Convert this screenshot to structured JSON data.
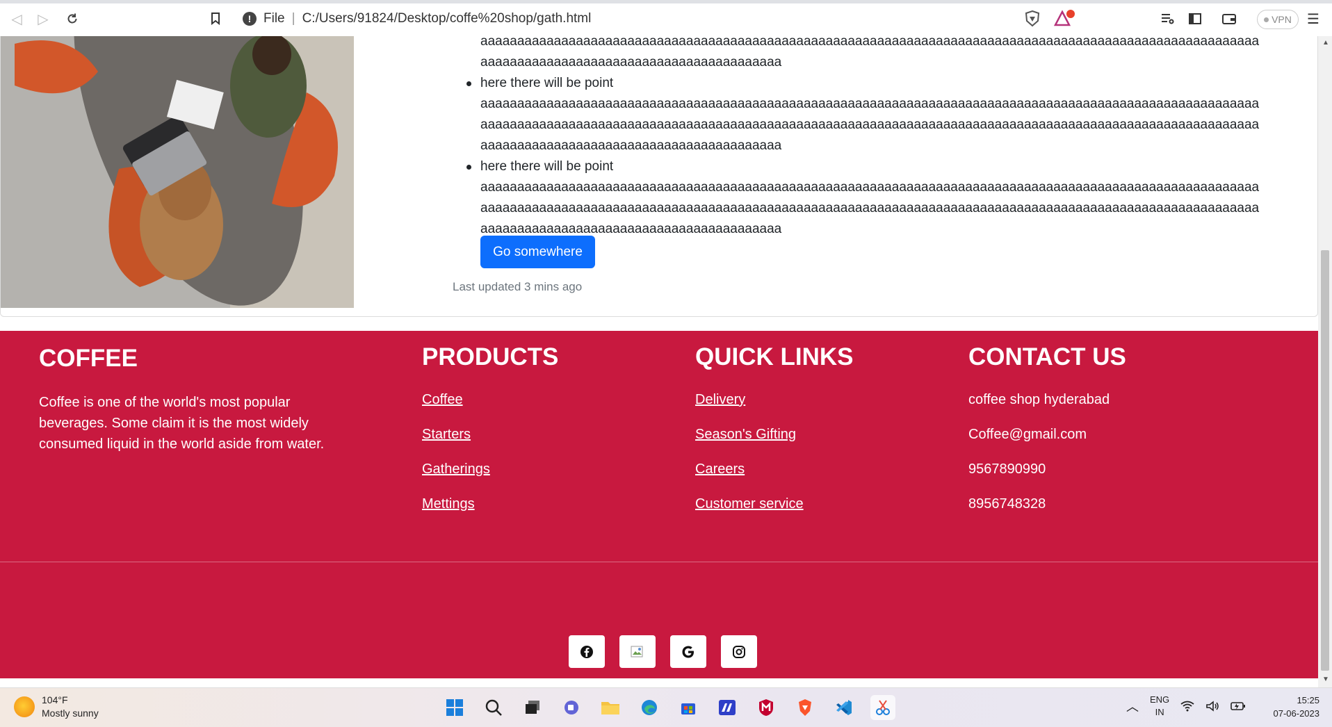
{
  "browser": {
    "url_scheme_label": "File",
    "url": "C:/Users/91824/Desktop/coffe%20shop/gath.html",
    "vpn_label": "VPN",
    "shield_badge": "1"
  },
  "card": {
    "points": [
      {
        "label": "",
        "fill_lines": [
          "aaaaaaaaaaaaaaaaaaaaaaaaaaaaaaaaaaaaaaaaaaaaaaaaaaaaaaaaaaaaaaaaaaaaaaaaaaaaaaaaaaaaaaaaaaaaaaaaaaaaaaaaaa",
          "aaaaaaaaaaaaaaaaaaaaaaaaaaaaaaaaaaaaaaaaa"
        ]
      },
      {
        "label": "here there will be point",
        "fill_lines": [
          "aaaaaaaaaaaaaaaaaaaaaaaaaaaaaaaaaaaaaaaaaaaaaaaaaaaaaaaaaaaaaaaaaaaaaaaaaaaaaaaaaaaaaaaaaaaaaaaaaaaaaaaaaa",
          "aaaaaaaaaaaaaaaaaaaaaaaaaaaaaaaaaaaaaaaaaaaaaaaaaaaaaaaaaaaaaaaaaaaaaaaaaaaaaaaaaaaaaaaaaaaaaaaaaaaaaaaaaa",
          "aaaaaaaaaaaaaaaaaaaaaaaaaaaaaaaaaaaaaaaaa"
        ]
      },
      {
        "label": "here there will be point",
        "fill_lines": [
          "aaaaaaaaaaaaaaaaaaaaaaaaaaaaaaaaaaaaaaaaaaaaaaaaaaaaaaaaaaaaaaaaaaaaaaaaaaaaaaaaaaaaaaaaaaaaaaaaaaaaaaaaaa",
          "aaaaaaaaaaaaaaaaaaaaaaaaaaaaaaaaaaaaaaaaaaaaaaaaaaaaaaaaaaaaaaaaaaaaaaaaaaaaaaaaaaaaaaaaaaaaaaaaaaaaaaaaaa",
          "aaaaaaaaaaaaaaaaaaaaaaaaaaaaaaaaaaaaaaaaa"
        ]
      }
    ],
    "button_label": "Go somewhere",
    "last_updated": "Last updated 3 mins ago"
  },
  "footer": {
    "about": {
      "title": "COFFEE",
      "text": "Coffee is one of the world's most popular beverages. Some claim it is the most widely consumed liquid in the world aside from water."
    },
    "products": {
      "title": "PRODUCTS",
      "links": [
        "Coffee",
        "Starters",
        "Gatherings",
        "Mettings"
      ]
    },
    "quick_links": {
      "title": "QUICK LINKS",
      "links": [
        "Delivery",
        "Season's Gifting",
        "Careers",
        "Customer service"
      ]
    },
    "contact": {
      "title": "CONTACT US",
      "items": [
        "coffee shop hyderabad",
        "Coffee@gmail.com",
        "9567890990",
        "8956748328"
      ]
    },
    "social_icons": [
      "facebook-icon",
      "twitter-icon",
      "google-icon",
      "instagram-icon"
    ],
    "brand_color": "#c8193f"
  },
  "taskbar": {
    "temperature": "104°F",
    "weather": "Mostly sunny",
    "lang_line1": "ENG",
    "lang_line2": "IN",
    "time": "15:25",
    "date": "07-06-2023"
  },
  "colors": {
    "primary_button": "#0d6efd",
    "footer_bg": "#c8193f"
  }
}
